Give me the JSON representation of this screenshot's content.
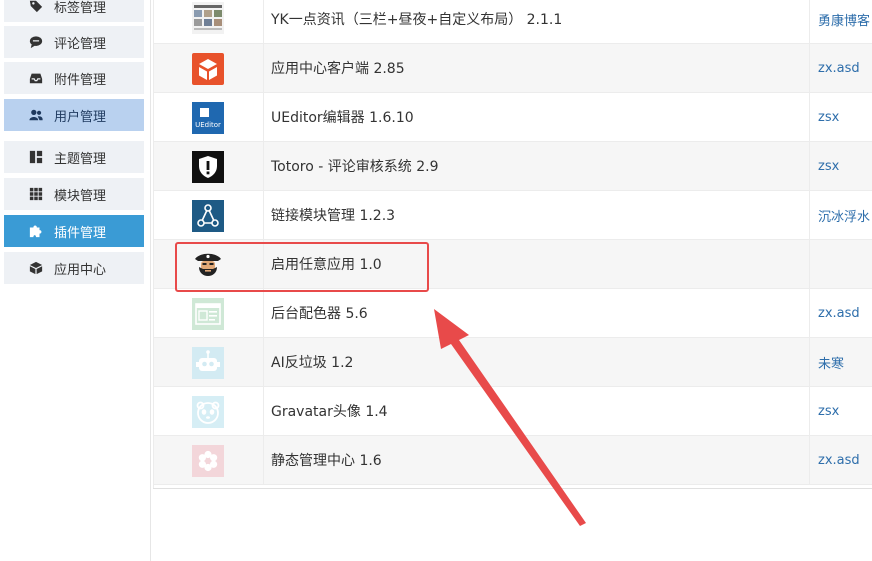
{
  "sidebar": {
    "items": [
      {
        "label": "标签管理",
        "icon": "tag-icon",
        "state": "normal"
      },
      {
        "label": "评论管理",
        "icon": "comment-icon",
        "state": "normal"
      },
      {
        "label": "附件管理",
        "icon": "inbox-icon",
        "state": "normal"
      },
      {
        "label": "用户管理",
        "icon": "users-icon",
        "state": "hover"
      },
      {
        "label": "主题管理",
        "icon": "layout-icon",
        "state": "normal"
      },
      {
        "label": "模块管理",
        "icon": "grid-icon",
        "state": "normal"
      },
      {
        "label": "插件管理",
        "icon": "puzzle-icon",
        "state": "active"
      },
      {
        "label": "应用中心",
        "icon": "box-icon",
        "state": "normal"
      }
    ]
  },
  "plugins": {
    "rows": [
      {
        "name": "YK一点资讯（三栏+昼夜+自定义布局） 2.1.1",
        "author": "勇康博客",
        "icon": "news-thumbnail-icon"
      },
      {
        "name": "应用中心客户端 2.85",
        "author": "zx.asd",
        "icon": "app-center-cube-icon"
      },
      {
        "name": "UEditor编辑器 1.6.10",
        "author": "zsx",
        "icon": "ueditor-icon"
      },
      {
        "name": "Totoro - 评论审核系统 2.9",
        "author": "zsx",
        "icon": "shield-alert-icon"
      },
      {
        "name": "链接模块管理 1.2.3",
        "author": "沉冰浮水",
        "icon": "share-nodes-icon"
      },
      {
        "name": "启用任意应用 1.0",
        "author": "",
        "icon": "pirate-icon"
      },
      {
        "name": "后台配色器 5.6",
        "author": "zx.asd",
        "icon": "palette-window-icon"
      },
      {
        "name": "AI反垃圾 1.2",
        "author": "未寒",
        "icon": "robot-icon"
      },
      {
        "name": "Gravatar头像 1.4",
        "author": "zsx",
        "icon": "panda-icon"
      },
      {
        "name": "静态管理中心 1.6",
        "author": "zx.asd",
        "icon": "flower-icon"
      }
    ]
  },
  "ueditor_icon_text": "UEditor",
  "colors": {
    "active": "#3a9bd5",
    "hover": "#b9d1ef",
    "link": "#2e6eab",
    "highlight": "#e84a4a"
  }
}
